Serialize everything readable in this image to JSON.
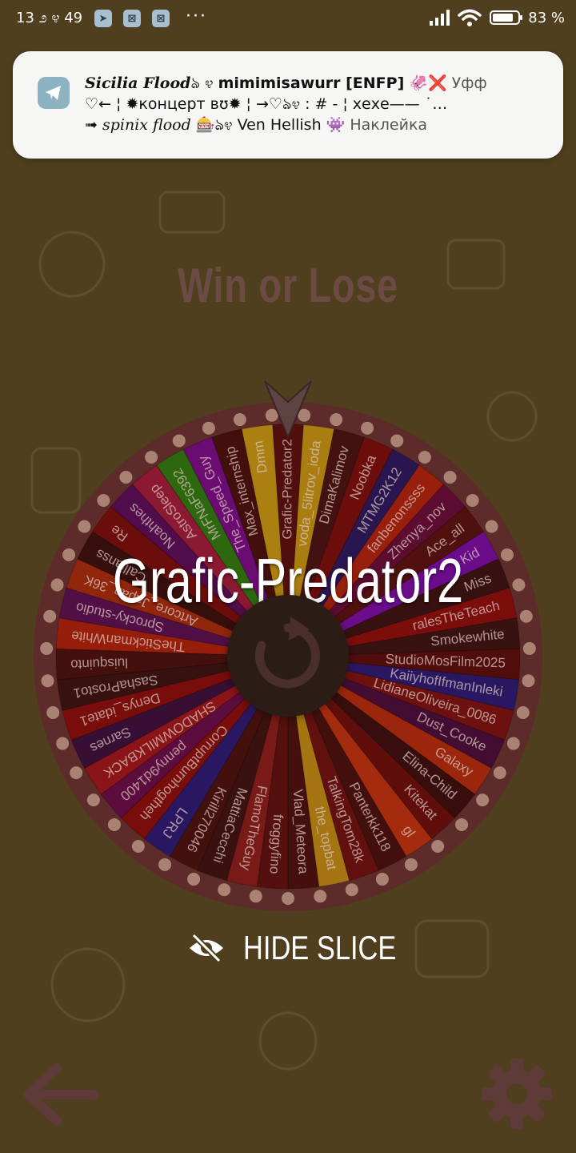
{
  "status_bar": {
    "time": "13 ೨ ೪ 49",
    "battery": "83 %",
    "battery_level": 0.83,
    "notification_icons": [
      "telegram-icon",
      "capcut-icon",
      "capcut-icon"
    ],
    "more": "···"
  },
  "notification": {
    "app_icon": "telegram-icon",
    "line1_script": "Sicilia Flood",
    "line1_deco": "ঌ ೪",
    "line1_name": "mimimisawurr [ENFP]",
    "line1_tail": "🦑❌ Уфф",
    "line2": "♡← ¦ ✹концерт вʊ✹ ¦ →♡ঌ೪ : # - ¦ хехе—— ˙…",
    "line3_prefix": "➟",
    "line3_italic": "spinix flood",
    "line3_mid": "🎰ঌ೪ Ven Hellish",
    "line3_sticker": "👾 Наклейка"
  },
  "title": "Win or Lose",
  "winner": "Grafic-Predator2",
  "hide_slice_label": "HIDE SLICE",
  "wheel": {
    "entries": [
      {
        "label": "Grafic-Predator2",
        "color": "#5a0d0d"
      },
      {
        "label": "voda_5litrov_ioda",
        "color": "#c79412"
      },
      {
        "label": "DimaKalimov",
        "color": "#4a1212"
      },
      {
        "label": "Noobka",
        "color": "#7a0c0c"
      },
      {
        "label": "MTMG2K12",
        "color": "#2a1660"
      },
      {
        "label": "fanbenonssss",
        "color": "#b0210c"
      },
      {
        "label": "Zhenya_nov",
        "color": "#6a0a3a"
      },
      {
        "label": "Ace_all",
        "color": "#5a0f0f"
      },
      {
        "label": "Kid",
        "color": "#7a0aa8"
      },
      {
        "label": "Miss",
        "color": "#3a1010"
      },
      {
        "label": "ralesTheTeach",
        "color": "#8e0c0c"
      },
      {
        "label": "Smokewhite",
        "color": "#3b1212"
      },
      {
        "label": "StudioMosFilm2025",
        "color": "#5a0b0b"
      },
      {
        "label": "KaiiyhofIfmanInleki",
        "color": "#2a1875"
      },
      {
        "label": "LidianeOliveira_0086",
        "color": "#7c1010"
      },
      {
        "label": "Dust_Cooke",
        "color": "#4a0b3c"
      },
      {
        "label": "Galaxy",
        "color": "#b52a0d"
      },
      {
        "label": "Elina-Child",
        "color": "#3c0d0d"
      },
      {
        "label": "Kitekat",
        "color": "#6c0d0d"
      },
      {
        "label": "gl",
        "color": "#c0300f"
      },
      {
        "label": "Panterkk118",
        "color": "#4a0e0e"
      },
      {
        "label": "TalkingTom28k",
        "color": "#6e0f0f"
      },
      {
        "label": "the_topbat",
        "color": "#c08a12"
      },
      {
        "label": "Vlad_Meteora",
        "color": "#4b0e0e"
      },
      {
        "label": "froggyfino",
        "color": "#5e0f10"
      },
      {
        "label": "FlamoTheGuy",
        "color": "#8a1b1b"
      },
      {
        "label": "MattiaCecchi",
        "color": "#3d1010"
      },
      {
        "label": "Kirill270046",
        "color": "#4a0f0f"
      },
      {
        "label": "LPRJ",
        "color": "#2a1975"
      },
      {
        "label": "CorruptBurnhogtheh",
        "color": "#8a0c0c"
      },
      {
        "label": "penny9d1400",
        "color": "#6a0a4a"
      },
      {
        "label": "SHADOWMILKBACK",
        "color": "#a0141a"
      },
      {
        "label": "Sarnes",
        "color": "#3b0d3d"
      },
      {
        "label": "Denys_idate1",
        "color": "#8a0c0c"
      },
      {
        "label": "SashaProsto1",
        "color": "#3a1010"
      },
      {
        "label": "luisquinto",
        "color": "#4a0f0f"
      },
      {
        "label": "TheStickmanWhite",
        "color": "#b0200c"
      },
      {
        "label": "Sprocky-studio",
        "color": "#5b0e52"
      },
      {
        "label": "Artcore_Japan_36K",
        "color": "#a82a0c"
      },
      {
        "label": "Callianss",
        "color": "#3a0e0e"
      },
      {
        "label": "Re",
        "color": "#7a0c0c"
      },
      {
        "label": "Noahthes",
        "color": "#5a0a5a"
      },
      {
        "label": "AstroSleep",
        "color": "#a01a3a"
      },
      {
        "label": "MrFNaF6392",
        "color": "#2f7a10"
      },
      {
        "label": "The_Speed_Guy",
        "color": "#7a0a8a"
      },
      {
        "label": "Max_internship",
        "color": "#4a0e0e"
      },
      {
        "label": "Dmm",
        "color": "#c99612"
      }
    ]
  },
  "colors": {
    "background": "#4f3f1f",
    "title": "#6b4b43",
    "wheel_rim": "#6a3030",
    "peg": "#c79a8c",
    "spin_bg": "#2b1d16",
    "spin_icon": "#4a2e2a"
  },
  "icons": {
    "hide": "eye-slash-icon",
    "spin": "refresh-icon",
    "back": "arrow-left-icon",
    "settings": "gear-icon",
    "pointer": "pointer-triangle-icon"
  }
}
